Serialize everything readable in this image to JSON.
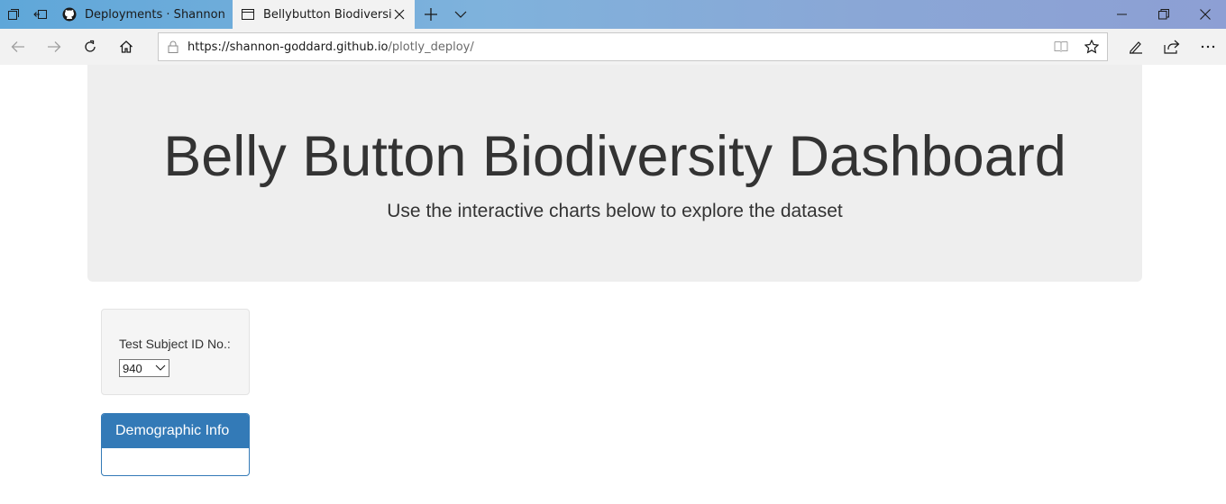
{
  "browser": {
    "tabs": [
      {
        "label": "Deployments · Shannon-Go",
        "icon": "github-icon",
        "active": false
      },
      {
        "label": "Bellybutton Biodiversity",
        "icon": "page-icon",
        "active": true
      }
    ],
    "address": {
      "url_host": "https://shannon-goddard.github.io",
      "url_path": "/plotly_deploy/"
    }
  },
  "page": {
    "title": "Belly Button Biodiversity Dashboard",
    "subtitle": "Use the interactive charts below to explore the dataset",
    "selector": {
      "label": "Test Subject ID No.:",
      "selected": "940"
    },
    "demographic_panel": {
      "heading": "Demographic Info"
    }
  },
  "colors": {
    "panel_primary": "#337ab7",
    "jumbotron_bg": "#eeeeee"
  }
}
